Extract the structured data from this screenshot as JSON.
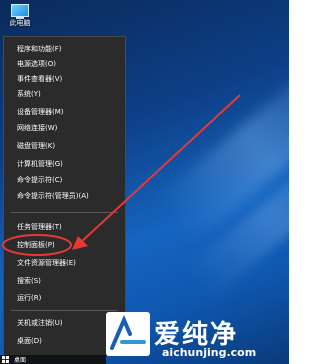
{
  "desktop": {
    "icon_label": "此电脑"
  },
  "menu": {
    "items": [
      {
        "label": "程序和功能(F)"
      },
      {
        "label": "电源选项(O)"
      },
      {
        "label": "事件查看器(V)"
      },
      {
        "label": "系统(Y)"
      },
      {
        "label": "设备管理器(M)"
      },
      {
        "label": "网络连接(W)"
      },
      {
        "label": "磁盘管理(K)"
      },
      {
        "label": "计算机管理(G)"
      },
      {
        "label": "命令提示符(C)"
      },
      {
        "label": "命令提示符(管理员)(A)"
      },
      {
        "label": "任务管理器(T)"
      },
      {
        "label": "控制面板(P)"
      },
      {
        "label": "文件资源管理器(E)"
      },
      {
        "label": "搜索(S)"
      },
      {
        "label": "运行(R)"
      },
      {
        "label": "关机或注销(U)",
        "submenu_arrow": ">"
      },
      {
        "label": "桌面(D)"
      }
    ],
    "highlighted": "控制面板(P)"
  },
  "taskbar": {
    "label": "桌面"
  },
  "watermark": {
    "brand": "爱纯净",
    "url": "aichunjing.com"
  },
  "colors": {
    "annotation": "#e53935",
    "menu_bg": "#2b2b2b"
  }
}
